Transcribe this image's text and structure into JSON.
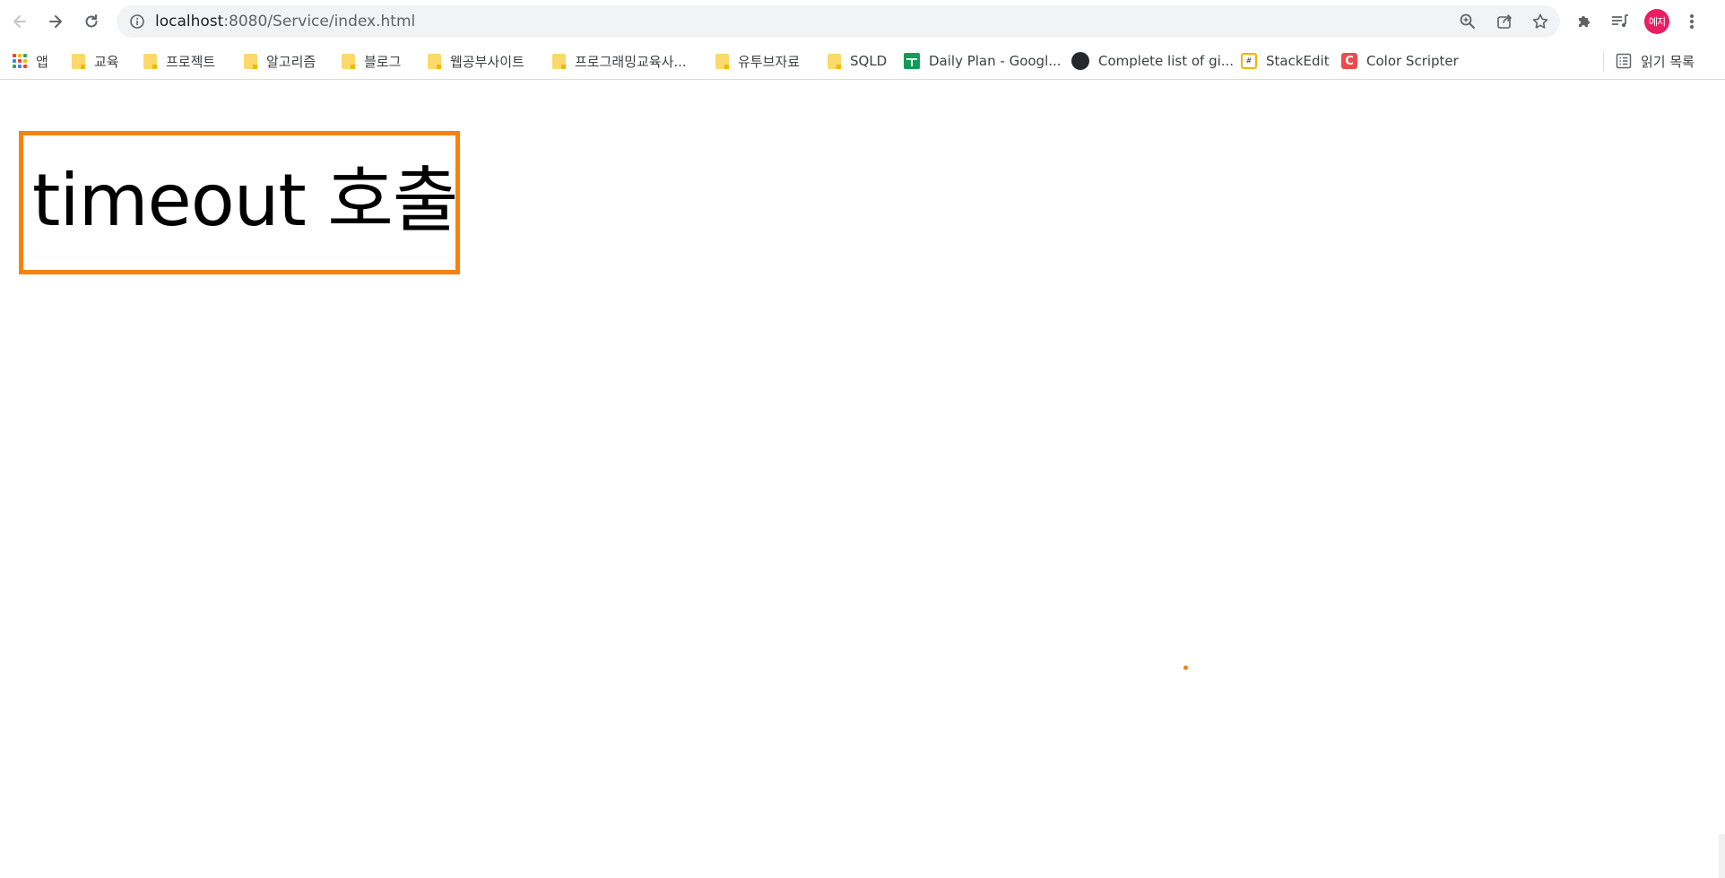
{
  "browser": {
    "url_host": "localhost",
    "url_rest": ":8080/Service/index.html",
    "nav": {
      "back_icon": "back-arrow-icon",
      "forward_icon": "forward-arrow-icon",
      "reload_icon": "reload-icon"
    },
    "profile_label": "예지",
    "accent_color": "#e91e63"
  },
  "bookmarks": {
    "items": [
      {
        "label": "앱",
        "icon": "apps-grid-icon"
      },
      {
        "label": "교육",
        "icon": "folder-icon"
      },
      {
        "label": "프로젝트",
        "icon": "folder-icon"
      },
      {
        "label": "알고리즘",
        "icon": "folder-icon"
      },
      {
        "label": "블로그",
        "icon": "folder-icon"
      },
      {
        "label": "웹공부사이트",
        "icon": "folder-icon"
      },
      {
        "label": "프로그래밍교육사...",
        "icon": "folder-icon"
      },
      {
        "label": "유투브자료",
        "icon": "folder-icon"
      },
      {
        "label": "SQLD",
        "icon": "folder-icon"
      },
      {
        "label": "Daily Plan - Googl...",
        "icon": "google-sheets-icon"
      },
      {
        "label": "Complete list of gi...",
        "icon": "github-icon"
      },
      {
        "label": "StackEdit",
        "icon": "stackedit-icon"
      },
      {
        "label": "Color Scripter",
        "icon": "color-scripter-icon"
      }
    ],
    "reading_list": "읽기 목록"
  },
  "page": {
    "text": "timeout 호출",
    "border_color": "#f7820d"
  }
}
